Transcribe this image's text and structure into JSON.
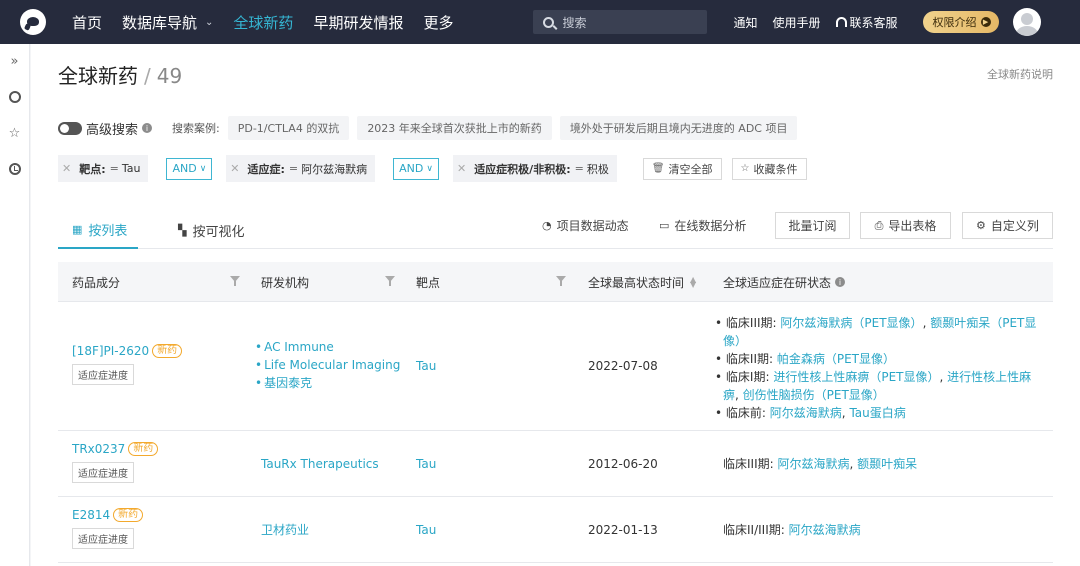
{
  "nav": {
    "items": [
      "首页",
      "数据库导航",
      "全球新药",
      "早期研发情报",
      "更多"
    ],
    "active_index": 2,
    "search_placeholder": "搜索",
    "right_items": [
      "通知",
      "使用手册",
      "联系客服"
    ],
    "vip_label": "权限介绍",
    "accent_color": "#35b6d3",
    "bg_color": "#262b3d"
  },
  "sidebar": {
    "icons": [
      "expand-icon",
      "chat-icon",
      "star-icon",
      "history-icon"
    ]
  },
  "page": {
    "title": "全球新药",
    "separator": "/",
    "count": "49",
    "explain_link": "全球新药说明"
  },
  "advanced": {
    "label": "高级搜索",
    "examples_label": "搜索案例:",
    "examples": [
      "PD-1/CTLA4 的双抗",
      "2023 年来全球首次获批上市的新药",
      "境外处于研发后期且境内无进度的 ADC 项目"
    ]
  },
  "filters": {
    "chips": [
      {
        "key": "靶点:",
        "value": "Tau"
      },
      {
        "key": "适应症:",
        "value": "阿尔兹海默病"
      },
      {
        "key": "适应症积极/非积极:",
        "value": "积极"
      }
    ],
    "operators": [
      "AND",
      "AND"
    ],
    "eq": "=",
    "clear_all": "清空全部",
    "save": "收藏条件"
  },
  "tabs": {
    "list": "按列表",
    "visual": "按可视化",
    "actions": [
      "项目数据动态",
      "在线数据分析"
    ],
    "buttons": [
      "批量订阅",
      "导出表格",
      "自定义列"
    ]
  },
  "table": {
    "headers": [
      "药品成分",
      "研发机构",
      "靶点",
      "全球最高状态时间",
      "全球适应症在研状态"
    ],
    "new_tag": "新药",
    "progress_label": "适应症进度",
    "rows": [
      {
        "drug": "[18F]PI-2620",
        "orgs": [
          "AC Immune",
          "Life Molecular Imaging",
          "基因泰克"
        ],
        "target": "Tau",
        "date": "2022-07-08",
        "status": [
          {
            "phase": "临床III期:",
            "parts": [
              "阿尔兹海默病（PET显像）",
              "额颞叶痴呆（PET显",
              "像）"
            ]
          },
          {
            "phase": "临床II期:",
            "parts": [
              "帕金森病（PET显像）"
            ]
          },
          {
            "phase": "临床I期:",
            "parts": [
              "进行性核上性麻痹（PET显像）",
              "进行性核上性麻",
              "痹",
              "创伤性脑损伤（PET显像）"
            ]
          },
          {
            "phase": "临床前:",
            "parts": [
              "阿尔兹海默病",
              "Tau蛋白病"
            ]
          }
        ]
      },
      {
        "drug": "TRx0237",
        "orgs": [
          "TauRx Therapeutics"
        ],
        "target": "Tau",
        "date": "2012-06-20",
        "status": [
          {
            "phase": "临床III期:",
            "parts": [
              "阿尔兹海默病",
              "额颞叶痴呆"
            ]
          }
        ]
      },
      {
        "drug": "E2814",
        "orgs": [
          "卫材药业"
        ],
        "target": "Tau",
        "date": "2022-01-13",
        "status": [
          {
            "phase": "临床II/III期:",
            "parts": [
              "阿尔兹海默病"
            ]
          }
        ]
      }
    ]
  }
}
